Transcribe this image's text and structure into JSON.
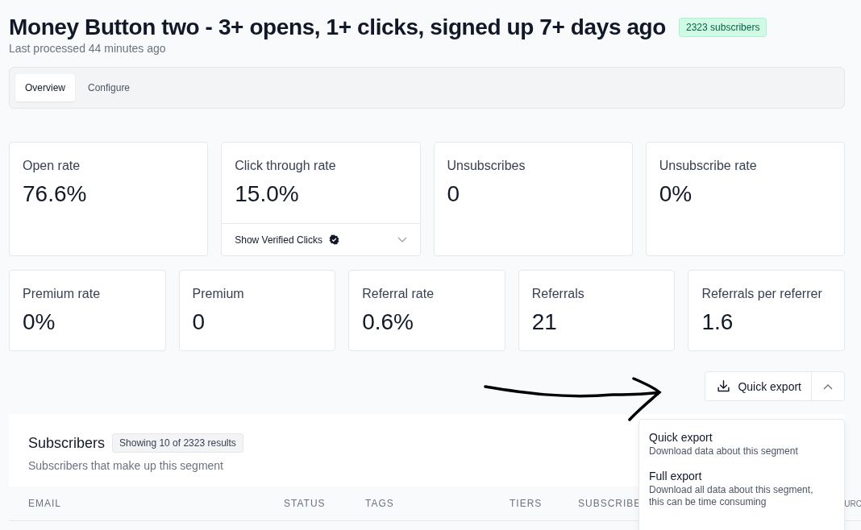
{
  "header": {
    "title": "Money Button two - 3+ opens, 1+ clicks, signed up 7+ days ago",
    "badge": "2323 subscribers",
    "subtitle": "Last processed 44 minutes ago"
  },
  "tabs": [
    {
      "label": "Overview",
      "selected": true
    },
    {
      "label": "Configure",
      "selected": false
    }
  ],
  "stats_row_1": [
    {
      "label": "Open rate",
      "value": "76.6%"
    },
    {
      "label": "Click through rate",
      "value": "15.0%",
      "footer": "Show Verified Clicks"
    },
    {
      "label": "Unsubscribes",
      "value": "0"
    },
    {
      "label": "Unsubscribe rate",
      "value": "0%"
    }
  ],
  "stats_row_2": [
    {
      "label": "Premium rate",
      "value": "0%"
    },
    {
      "label": "Premium",
      "value": "0"
    },
    {
      "label": "Referral rate",
      "value": "0.6%"
    },
    {
      "label": "Referrals",
      "value": "21"
    },
    {
      "label": "Referrals per referrer",
      "value": "1.6"
    }
  ],
  "export": {
    "label": "Quick export",
    "expanded": true,
    "menu": [
      {
        "title": "Quick export",
        "description": "Download data about this segment"
      },
      {
        "title": "Full export",
        "description": "Download all data about this segment, this can be time consuming"
      }
    ]
  },
  "subscribers": {
    "title": "Subscribers",
    "badge": "Showing 10 of 2323 results",
    "subtitle": "Subscribers that make up this segment",
    "columns": [
      "EMAIL",
      "STATUS",
      "TAGS",
      "TIERS",
      "SUBSCRIBE",
      "URC"
    ]
  }
}
